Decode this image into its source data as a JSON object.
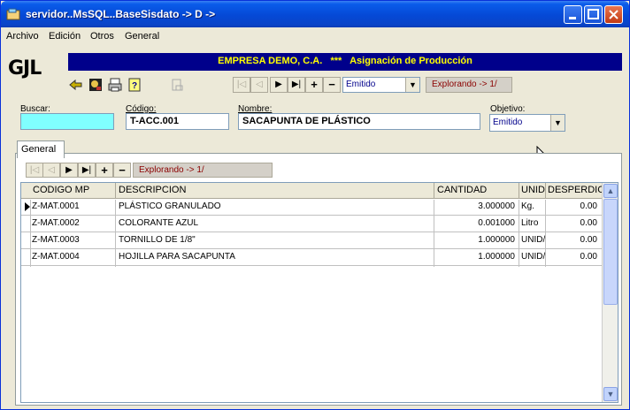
{
  "window": {
    "title": "servidor..MsSQL..BaseSisdato -> D ->"
  },
  "menu": [
    "Archivo",
    "Edición",
    "Otros",
    "General"
  ],
  "header": {
    "logo": "GJL",
    "company": "EMPRESA DEMO, C.A.",
    "stars": "***",
    "module": "Asignación de Producción"
  },
  "toolbar": {
    "status_value": "Emitido",
    "explorer": "Explorando -> 1/"
  },
  "form": {
    "buscar_label": "Buscar:",
    "buscar_value": "",
    "codigo_label": "Código:",
    "codigo_value": "T-ACC.001",
    "nombre_label": "Nombre:",
    "nombre_value": "SACAPUNTA DE PLÁSTICO",
    "objetivo_label": "Objetivo:",
    "objetivo_value": "Emitido"
  },
  "tabs": {
    "general": "General"
  },
  "subtoolbar": {
    "explorer": "Explorando -> 1/"
  },
  "grid": {
    "columns": [
      "CODIGO MP",
      "DESCRIPCION",
      "CANTIDAD",
      "UNID",
      "DESPERDIC"
    ],
    "rows": [
      {
        "codigo": "Z-MAT.0001",
        "descripcion": "PLÁSTICO GRANULADO",
        "cantidad": "3.000000",
        "unidad": "Kg.",
        "desperdicio": "0.00"
      },
      {
        "codigo": "Z-MAT.0002",
        "descripcion": "COLORANTE AZUL",
        "cantidad": "0.001000",
        "unidad": "Litro",
        "desperdicio": "0.00"
      },
      {
        "codigo": "Z-MAT.0003",
        "descripcion": "TORNILLO DE 1/8\"",
        "cantidad": "1.000000",
        "unidad": "UNID/",
        "desperdicio": "0.00"
      },
      {
        "codigo": "Z-MAT.0004",
        "descripcion": "HOJILLA PARA SACAPUNTA",
        "cantidad": "1.000000",
        "unidad": "UNID/",
        "desperdicio": "0.00"
      }
    ]
  },
  "colors": {
    "company_bar": "#00008b",
    "company_text": "#ffff00",
    "buscar_bg": "#80ffff"
  }
}
